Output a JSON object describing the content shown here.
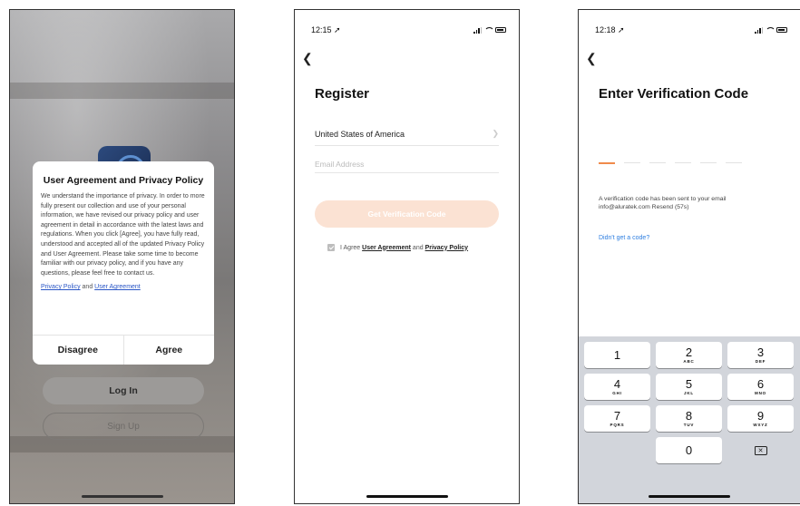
{
  "screen1": {
    "dialog": {
      "title": "User Agreement and Privacy Policy",
      "body": "We understand the importance of privacy. In order to more fully present our collection and use of your personal information, we have revised our privacy policy and user agreement in detail in accordance with the latest laws and regulations. When you click [Agree], you have fully read, understood and accepted all of the updated Privacy Policy and User Agreement. Please take some time to become familiar with our privacy policy, and if you have any questions, please feel free to contact us.",
      "privacy_link": "Privacy Policy",
      "and": "and",
      "user_agreement_link": "User Agreement",
      "disagree_label": "Disagree",
      "agree_label": "Agree"
    },
    "login_label": "Log In",
    "signup_label": "Sign Up"
  },
  "screen2": {
    "status_time": "12:15",
    "back_icon": "chevron-left-icon",
    "title": "Register",
    "country": "United States of America",
    "email_placeholder": "Email Address",
    "get_code_label": "Get Verification Code",
    "agree_prefix": "I Agree",
    "user_agreement_link": "User Agreement",
    "and": "and",
    "privacy_link": "Privacy Policy"
  },
  "screen3": {
    "status_time": "12:18",
    "back_icon": "chevron-left-icon",
    "title": "Enter Verification Code",
    "message_line1": "A verification code has been sent to your email",
    "message_line2": "info@aluratek.com  Resend (57s)",
    "didnt_get": "Didn't get a code?",
    "keys": [
      {
        "num": "1",
        "letters": ""
      },
      {
        "num": "2",
        "letters": "ABC"
      },
      {
        "num": "3",
        "letters": "DEF"
      },
      {
        "num": "4",
        "letters": "GHI"
      },
      {
        "num": "5",
        "letters": "JKL"
      },
      {
        "num": "6",
        "letters": "MNO"
      },
      {
        "num": "7",
        "letters": "PQRS"
      },
      {
        "num": "8",
        "letters": "TUV"
      },
      {
        "num": "9",
        "letters": "WXYZ"
      },
      {
        "num": "0",
        "letters": ""
      }
    ]
  },
  "colors": {
    "accent_orange": "#f08a4b",
    "disabled_button": "#fbe2d3",
    "link_blue": "#2a56c6",
    "keypad_bg": "#d2d5db"
  }
}
